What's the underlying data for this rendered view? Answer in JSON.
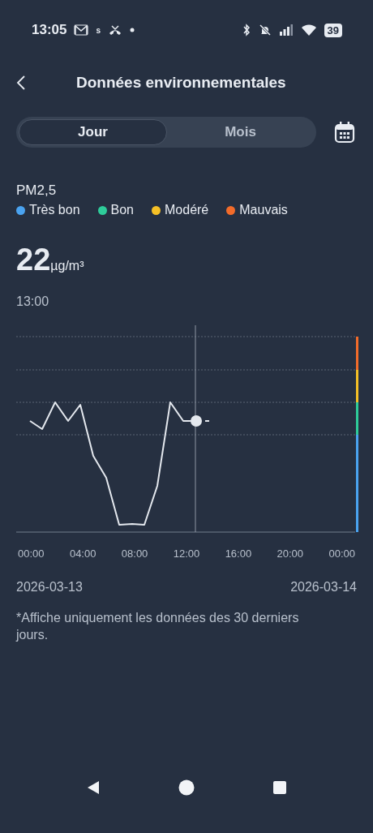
{
  "status_bar": {
    "time": "13:05",
    "notification_glyph": "s",
    "battery": "39"
  },
  "header": {
    "title": "Données environnementales"
  },
  "tabs": [
    {
      "label": "Jour",
      "selected": true
    },
    {
      "label": "Mois",
      "selected": false
    }
  ],
  "metric": {
    "name": "PM2,5",
    "value": "22",
    "unit": "µg/m³",
    "time": "13:00"
  },
  "legend": [
    {
      "label": "Très bon",
      "color": "#4aa3f0"
    },
    {
      "label": "Bon",
      "color": "#2ecc9a"
    },
    {
      "label": "Modéré",
      "color": "#f5c026"
    },
    {
      "label": "Mauvais",
      "color": "#f26b2a"
    }
  ],
  "chart": {
    "x_labels": [
      "00:00",
      "04:00",
      "08:00",
      "12:00",
      "16:00",
      "20:00",
      "00:00"
    ],
    "start_date": "2026-03-13",
    "end_date": "2026-03-14"
  },
  "note": "*Affiche uniquement les données des 30 derniers jours."
}
